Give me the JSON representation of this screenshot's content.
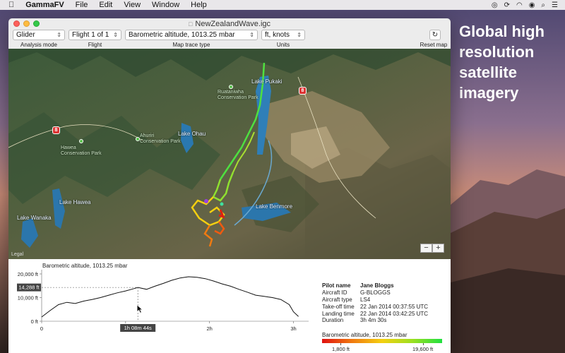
{
  "menubar": {
    "app": "GammaFV",
    "items": [
      "File",
      "Edit",
      "View",
      "Window",
      "Help"
    ]
  },
  "promo": [
    "Global high",
    "resolution",
    "satellite",
    "imagery"
  ],
  "window": {
    "title": "NewZealandWave.igc"
  },
  "toolbar": {
    "analysis_mode": {
      "value": "Glider",
      "label": "Analysis mode"
    },
    "flight": {
      "value": "Flight 1 of 1",
      "label": "Flight"
    },
    "trace_type": {
      "value": "Barometric altitude, 1013.25 mbar",
      "label": "Map trace type"
    },
    "units": {
      "value": "ft, knots",
      "label": "Units"
    },
    "reset": {
      "label": "Reset map"
    }
  },
  "map": {
    "places": [
      "Lake Pukaki",
      "Lake Ohau",
      "Lake Hawea",
      "Lake Wanaka",
      "Lake Benmore"
    ],
    "parks": [
      "Ruataniwha Conservation Park",
      "Ahuriri Conservation Park",
      "Hawea Conservation Park"
    ],
    "shields": [
      "8",
      "8"
    ],
    "legal": "Legal",
    "zoom_out": "−",
    "zoom_in": "+"
  },
  "chart": {
    "title": "Barometric altitude, 1013.25 mbar",
    "y_ticks": [
      "20,000 ft",
      "10,000 ft",
      "0 ft"
    ],
    "x_ticks": [
      "0",
      "1h",
      "2h",
      "3h"
    ],
    "cursor_value": "14,288 ft",
    "cursor_time": "1h 08m 44s"
  },
  "chart_data": {
    "type": "line",
    "title": "Barometric altitude, 1013.25 mbar",
    "xlabel": "",
    "ylabel": "",
    "x_unit": "hours",
    "xlim": [
      0,
      3.08
    ],
    "ylim": [
      0,
      20000
    ],
    "grid": false,
    "x": [
      0,
      0.1,
      0.2,
      0.3,
      0.4,
      0.5,
      0.6,
      0.7,
      0.8,
      0.9,
      1.0,
      1.1,
      1.146,
      1.25,
      1.35,
      1.45,
      1.55,
      1.65,
      1.75,
      1.85,
      1.95,
      2.05,
      2.15,
      2.25,
      2.35,
      2.45,
      2.55,
      2.65,
      2.75,
      2.85,
      2.95,
      3.0,
      3.06
    ],
    "values": [
      1800,
      4500,
      7000,
      8000,
      7500,
      8500,
      9200,
      10000,
      11000,
      12000,
      12800,
      13800,
      14288,
      13500,
      14800,
      16000,
      17300,
      18300,
      18800,
      18600,
      18000,
      17000,
      15800,
      14800,
      13500,
      12300,
      11000,
      10500,
      10000,
      9200,
      7000,
      4000,
      2000
    ]
  },
  "pilot": {
    "rows": [
      {
        "k": "Pilot name",
        "v": "Jane Bloggs"
      },
      {
        "k": "Aircraft ID",
        "v": "G-BLOGGS"
      },
      {
        "k": "Aircraft type",
        "v": "LS4"
      },
      {
        "k": "Take-off time",
        "v": "22 Jan 2014 00:37:55 UTC"
      },
      {
        "k": "Landing time",
        "v": "22 Jan 2014 03:42:25 UTC"
      },
      {
        "k": "Duration",
        "v": "3h 4m 30s"
      }
    ]
  },
  "legend": {
    "title": "Barometric altitude, 1013.25 mbar",
    "min": "1,800 ft",
    "max": "19,600 ft",
    "colors": [
      "#e01010",
      "#f07a10",
      "#f4d010",
      "#9de020",
      "#20e040"
    ]
  }
}
